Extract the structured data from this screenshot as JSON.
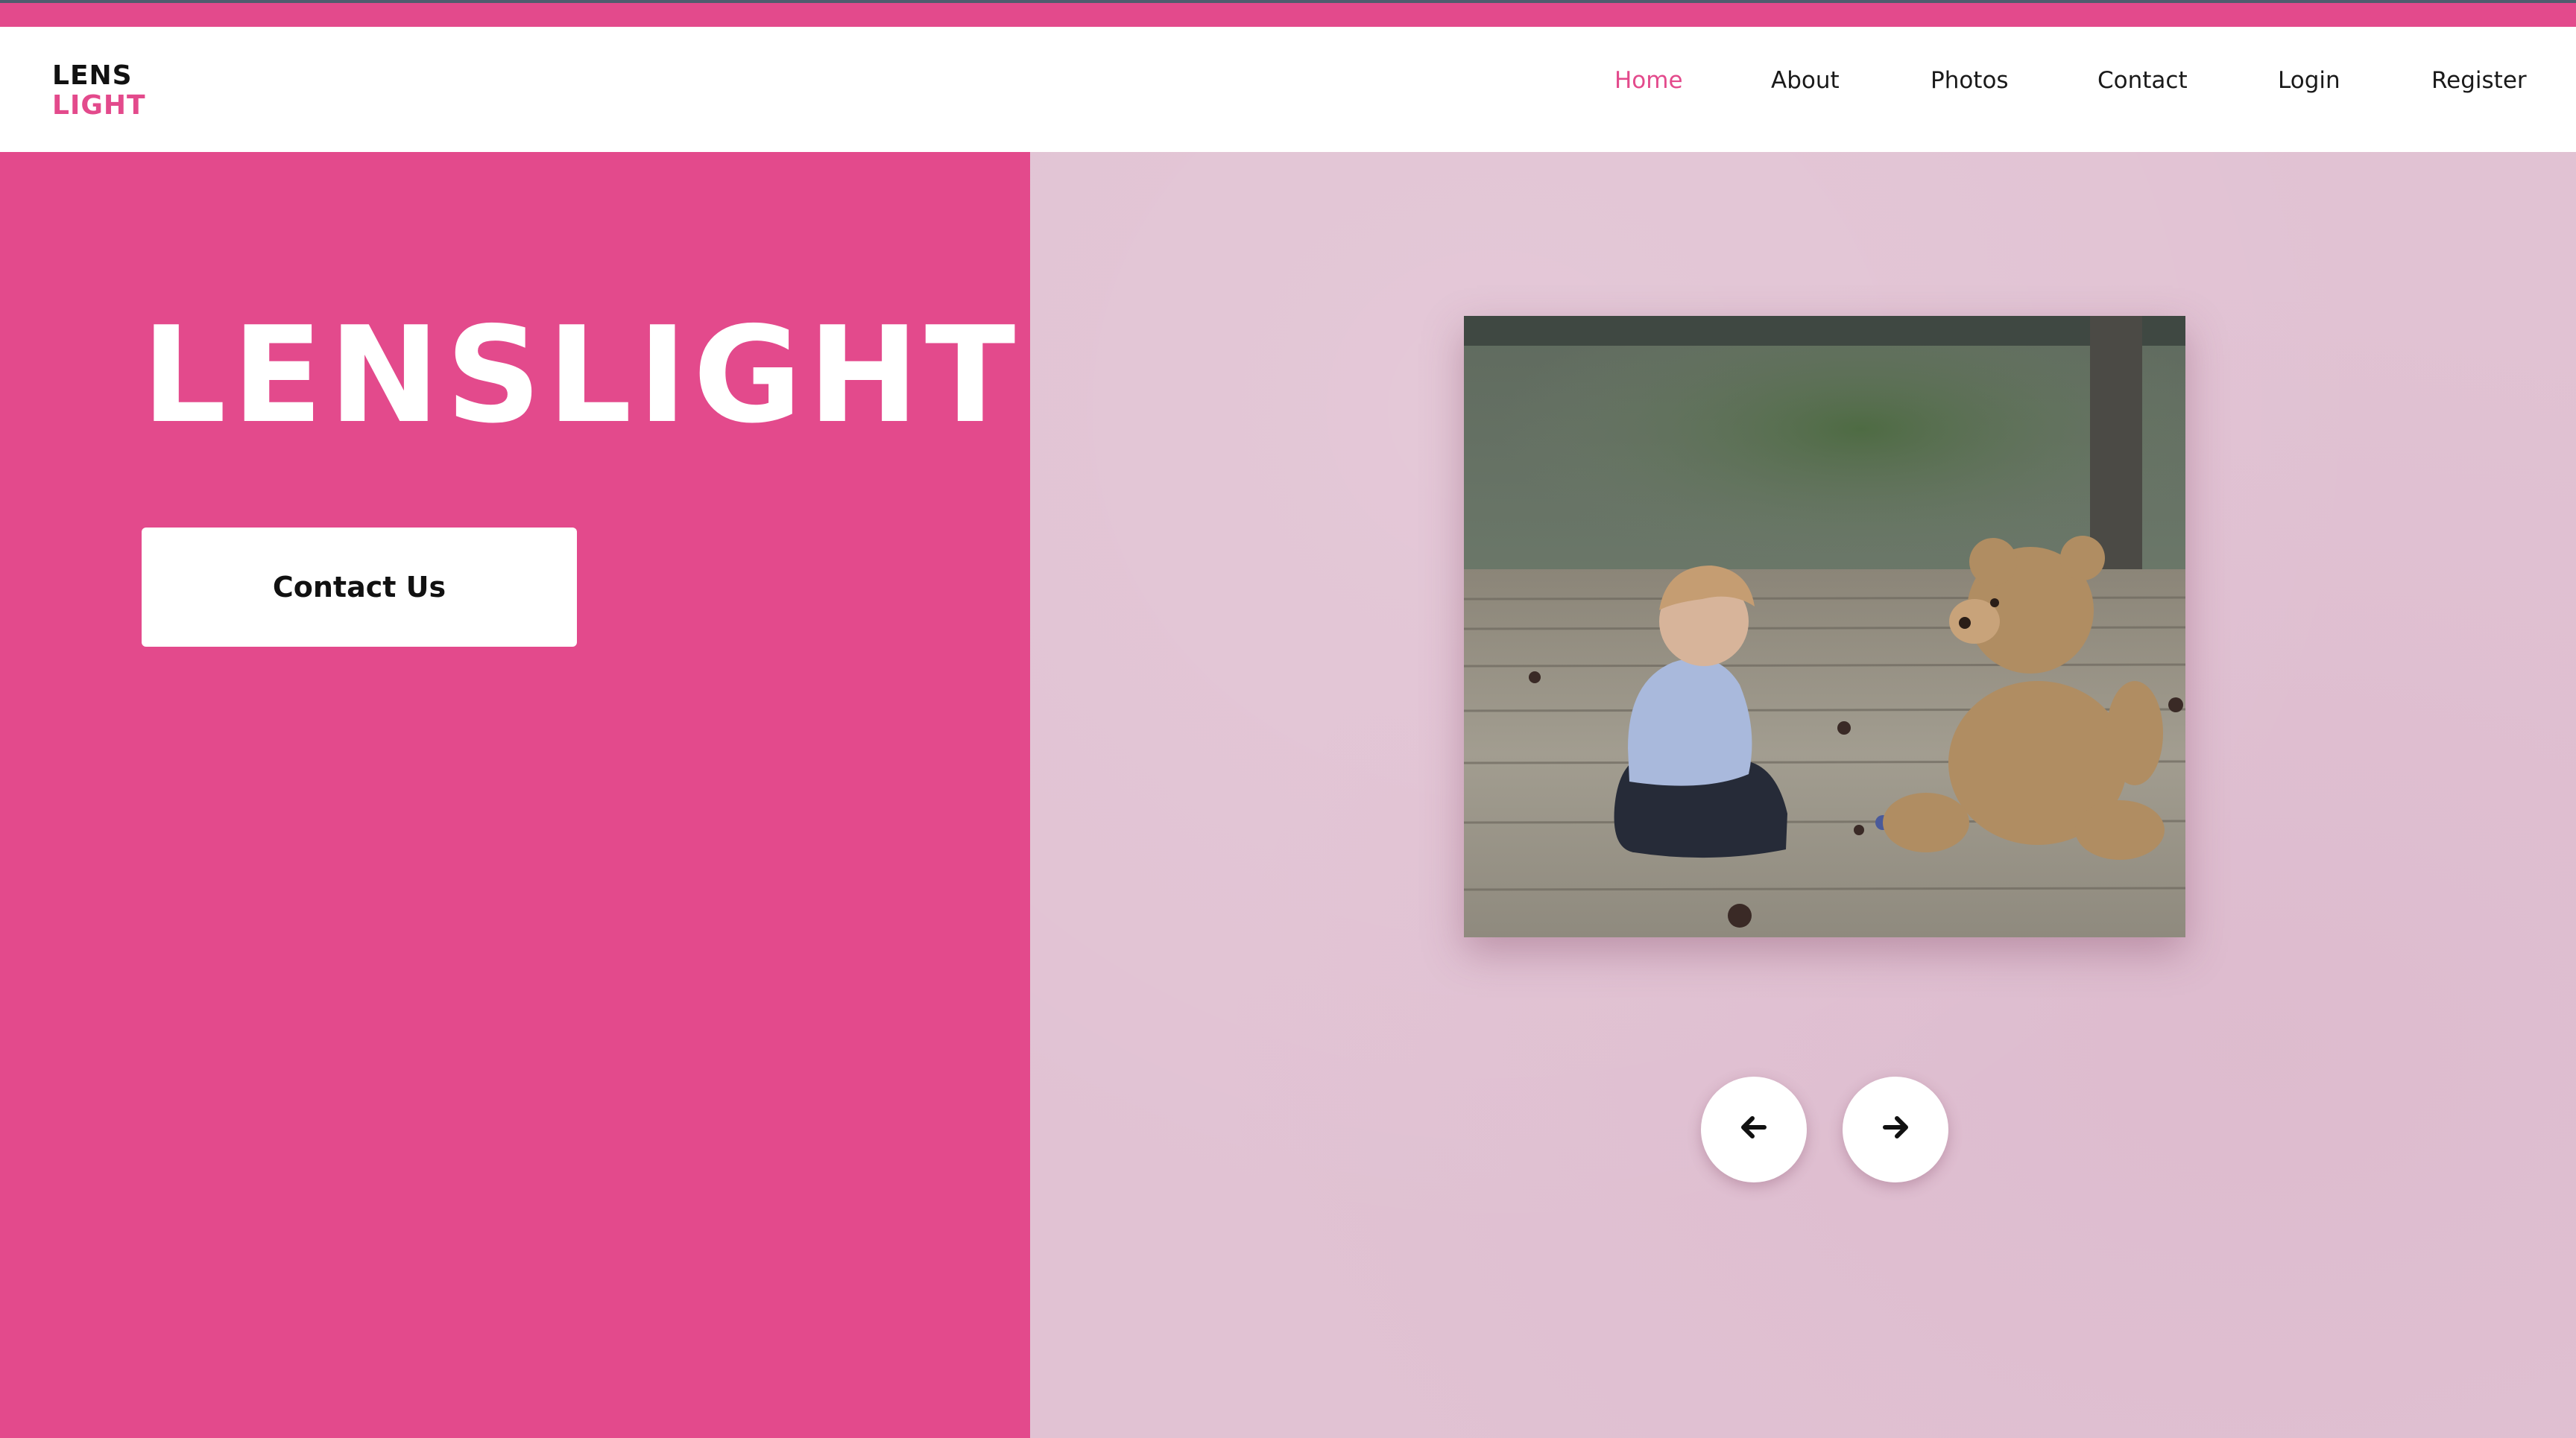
{
  "brand": {
    "line1": "LENS",
    "line2": "LIGHT",
    "accent_color": "#e34a8c"
  },
  "nav": {
    "items": [
      {
        "label": "Home",
        "active": true
      },
      {
        "label": "About",
        "active": false
      },
      {
        "label": "Photos",
        "active": false
      },
      {
        "label": "Contact",
        "active": false
      },
      {
        "label": "Login",
        "active": false
      },
      {
        "label": "Register",
        "active": false
      }
    ]
  },
  "hero": {
    "title": "LENSLIGHT",
    "cta_label": "Contact Us",
    "left_bg": "#e34a8c",
    "right_bg": "#e1c2d3"
  },
  "carousel": {
    "image_subject": "child-with-teddy-bear-photo",
    "prev_icon": "arrow-left-icon",
    "next_icon": "arrow-right-icon",
    "prev_glyph": "🡐",
    "next_glyph": "🡒"
  }
}
